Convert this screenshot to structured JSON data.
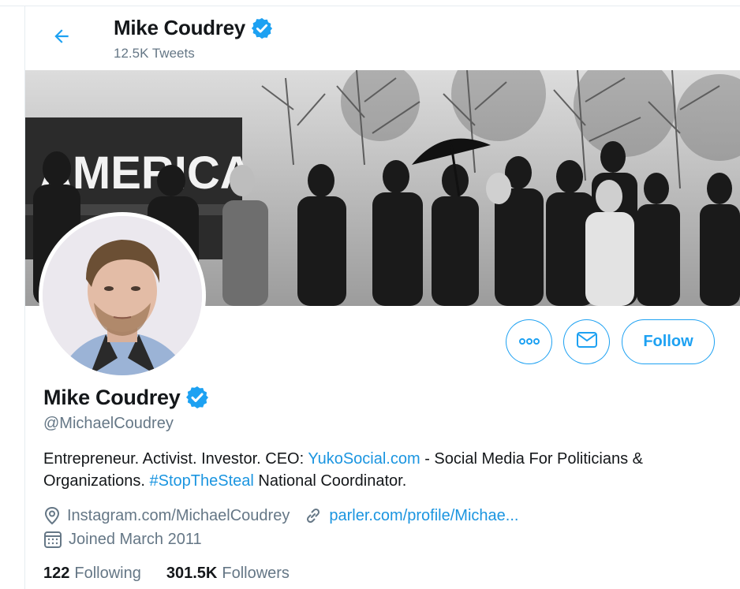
{
  "header": {
    "name": "Mike Coudrey",
    "tweets_count": "12.5K Tweets"
  },
  "banner": {
    "sign_text": "AMERICA"
  },
  "profile": {
    "name": "Mike Coudrey",
    "handle": "@MichaelCoudrey",
    "bio": {
      "part1": "Entrepreneur. Activist. Investor. CEO: ",
      "link1": "YukoSocial.com",
      "part2": " - Social Media For Politicians & Organizations. ",
      "hashtag": "#StopTheSteal",
      "part3": " National Coordinator."
    },
    "location": "Instagram.com/MichaelCoudrey",
    "website": "parler.com/profile/Michae...",
    "joined": "Joined March 2011"
  },
  "actions": {
    "follow_label": "Follow"
  },
  "stats": {
    "following_count": "122",
    "following_label": "Following",
    "followers_count": "301.5K",
    "followers_label": "Followers"
  },
  "icons": {
    "back": "arrow-left-icon",
    "verified": "verified-badge-icon",
    "more": "more-dots-icon",
    "message": "envelope-icon",
    "location": "location-pin-icon",
    "link": "link-icon",
    "calendar": "calendar-icon"
  },
  "colors": {
    "accent": "#1da1f2",
    "link": "#1b95e0",
    "secondary_text": "#657786",
    "primary_text": "#14171a"
  }
}
